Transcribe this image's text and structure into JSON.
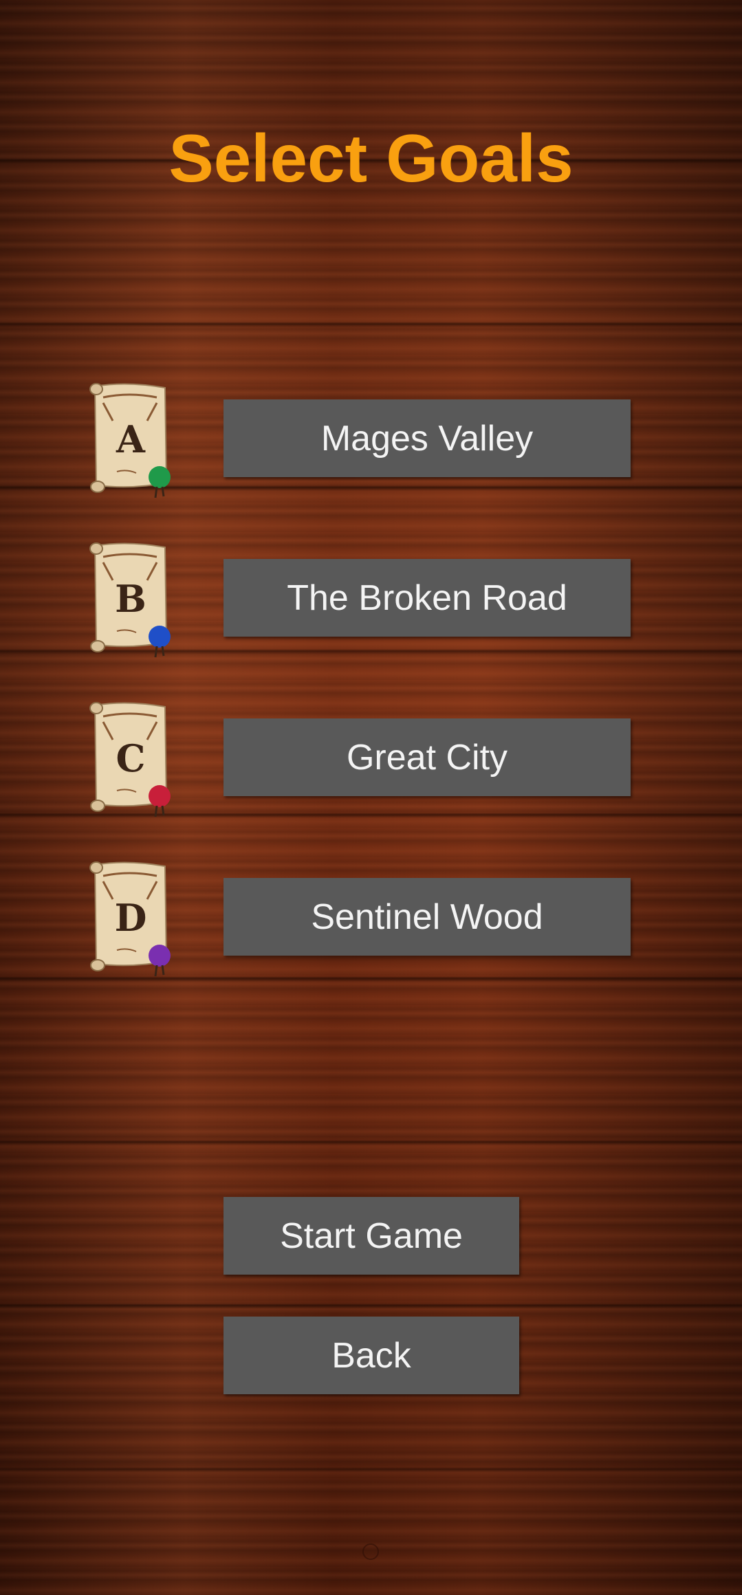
{
  "screen": {
    "title": "Select Goals"
  },
  "goals": [
    {
      "letter": "A",
      "label": "Mages Valley",
      "seal_color": "#1f9a4a"
    },
    {
      "letter": "B",
      "label": "The Broken Road",
      "seal_color": "#1f4fc8"
    },
    {
      "letter": "C",
      "label": "Great City",
      "seal_color": "#c81f3a"
    },
    {
      "letter": "D",
      "label": "Sentinel Wood",
      "seal_color": "#7a2fb0"
    }
  ],
  "actions": {
    "start_label": "Start Game",
    "back_label": "Back"
  },
  "colors": {
    "title": "#f9a010",
    "button_bg": "#595959",
    "button_text": "#f4f4f4",
    "parchment": "#ead7b3",
    "ink": "#3a2416"
  }
}
